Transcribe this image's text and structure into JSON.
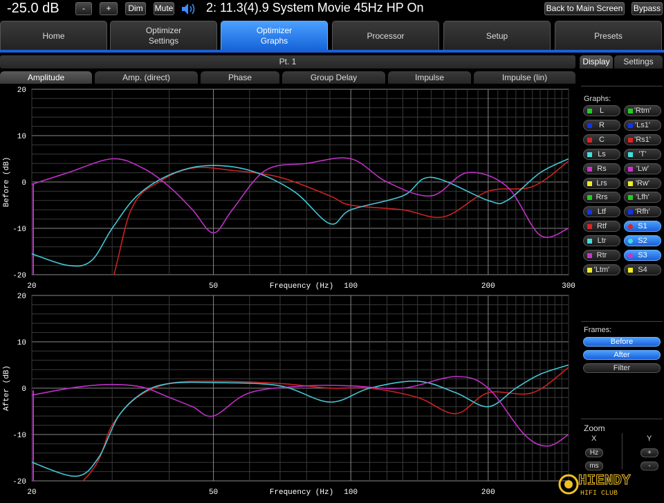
{
  "topbar": {
    "volume": "-25.0 dB",
    "minus_label": "-",
    "plus_label": "+",
    "dim_label": "Dim",
    "mute_label": "Mute",
    "status": "2: 11.3(4).9 System Movie 45Hz HP On",
    "back_label": "Back to Main Screen",
    "bypass_label": "Bypass"
  },
  "tabs": [
    {
      "label": "Home"
    },
    {
      "label": "Optimizer\nSettings"
    },
    {
      "label": "Optimizer\nGraphs"
    },
    {
      "label": "Processor"
    },
    {
      "label": "Setup"
    },
    {
      "label": "Presets"
    }
  ],
  "point_label": "Pt. 1",
  "graph_tabs": [
    "Amplitude",
    "Amp. (direct)",
    "Phase",
    "Group Delay",
    "Impulse",
    "Impulse (lin)"
  ],
  "right_tabs": [
    "Display",
    "Settings"
  ],
  "graphs_label": "Graphs:",
  "channels_left": [
    {
      "label": "L",
      "color": "#22cc22"
    },
    {
      "label": "R",
      "color": "#1133ee"
    },
    {
      "label": "C",
      "color": "#dd2222"
    },
    {
      "label": "Ls",
      "color": "#44dddd"
    },
    {
      "label": "Rs",
      "color": "#cc33cc"
    },
    {
      "label": "Lrs",
      "color": "#eeee22"
    },
    {
      "label": "Rrs",
      "color": "#22cc22"
    },
    {
      "label": "Ltf",
      "color": "#1133ee"
    },
    {
      "label": "Rtf",
      "color": "#dd2222"
    },
    {
      "label": "Ltr",
      "color": "#44dddd"
    },
    {
      "label": "Rtr",
      "color": "#cc33cc"
    },
    {
      "label": "'Ltm'",
      "color": "#eeee22"
    }
  ],
  "channels_right": [
    {
      "label": "'Rtm'",
      "color": "#22cc22"
    },
    {
      "label": "'Ls1'",
      "color": "#1133ee"
    },
    {
      "label": "'Rs1'",
      "color": "#dd2222"
    },
    {
      "label": "'T'",
      "color": "#44dddd"
    },
    {
      "label": "'Lw'",
      "color": "#cc33cc"
    },
    {
      "label": "'Rw'",
      "color": "#eeee22"
    },
    {
      "label": "'Lfh'",
      "color": "#22cc22"
    },
    {
      "label": "'Rfh'",
      "color": "#1133ee"
    },
    {
      "label": "S1",
      "color": "#dd2222",
      "selected": true
    },
    {
      "label": "S2",
      "color": "#44dddd",
      "selected": true
    },
    {
      "label": "S3",
      "color": "#cc33cc",
      "selected": true
    },
    {
      "label": "S4",
      "color": "#eeee22"
    }
  ],
  "frames_label": "Frames:",
  "frames": [
    {
      "label": "Before",
      "selected": true
    },
    {
      "label": "After",
      "selected": true
    },
    {
      "label": "Filter",
      "selected": false
    }
  ],
  "zoom": {
    "label": "Zoom",
    "x_label": "X",
    "y_label": "Y",
    "hz_label": "Hz",
    "ms_label": "ms",
    "plus_label": "+",
    "minus_label": "-"
  },
  "watermark": {
    "text": "HIENDY",
    "subtext": "HIFI CLUB"
  },
  "chart_data": [
    {
      "type": "line",
      "ylabel": "Before (dB)",
      "xlabel": "Frequency (Hz)",
      "xscale": "log",
      "xlim": [
        20,
        300
      ],
      "ylim": [
        -20,
        20
      ],
      "xticks": [
        20,
        50,
        100,
        200,
        300
      ],
      "yticks": [
        20,
        10,
        0,
        -10,
        -20
      ],
      "series": [
        {
          "color": "#cc2222",
          "x": [
            20,
            28,
            33,
            38,
            45,
            55,
            70,
            90,
            100,
            130,
            160,
            200,
            250,
            300
          ],
          "y": [
            -30,
            -28,
            -6,
            0,
            3,
            2.5,
            1,
            -3,
            -5,
            -6,
            -7.5,
            -2,
            -1,
            4.5
          ]
        },
        {
          "color": "#44c8d8",
          "x": [
            20,
            24,
            27,
            30,
            34,
            40,
            48,
            60,
            75,
            90,
            100,
            130,
            150,
            200,
            220,
            260,
            300
          ],
          "y": [
            -15.5,
            -18,
            -17,
            -10,
            -3,
            1.5,
            3.5,
            2.5,
            -2,
            -9,
            -6,
            -3,
            1,
            -4,
            -4,
            2,
            5
          ]
        },
        {
          "color": "#c030c8",
          "x": [
            20,
            24,
            30,
            35,
            40,
            45,
            50,
            55,
            65,
            80,
            100,
            120,
            150,
            180,
            220,
            260,
            300
          ],
          "y": [
            -0.5,
            2,
            5,
            3,
            -1,
            -6,
            -11,
            -6,
            2.5,
            4,
            5,
            0,
            -3,
            2,
            -1,
            -11.5,
            -10
          ]
        }
      ]
    },
    {
      "type": "line",
      "ylabel": "After (dB)",
      "xlabel": "Frequency (Hz)",
      "xscale": "log",
      "xlim": [
        20,
        300
      ],
      "ylim": [
        -20,
        20
      ],
      "xticks": [
        20,
        50,
        100,
        200
      ],
      "yticks": [
        20,
        10,
        0,
        -10,
        -20
      ],
      "series": [
        {
          "color": "#cc2222",
          "x": [
            20,
            27,
            30,
            34,
            40,
            50,
            70,
            90,
            110,
            140,
            170,
            200,
            250,
            300
          ],
          "y": [
            -30,
            -18,
            -8,
            -2,
            1,
            1.5,
            1,
            0,
            0,
            -2,
            -5.5,
            -1,
            -1,
            4.5
          ]
        },
        {
          "color": "#44c8d8",
          "x": [
            20,
            25,
            28,
            31,
            35,
            40,
            50,
            70,
            90,
            110,
            140,
            170,
            200,
            230,
            260,
            300
          ],
          "y": [
            -16,
            -19,
            -15,
            -6,
            -1,
            1,
            1.2,
            0.5,
            -3,
            0,
            1.5,
            -1,
            -4,
            0,
            3,
            5
          ]
        },
        {
          "color": "#c030c8",
          "x": [
            20,
            25,
            30,
            35,
            40,
            45,
            50,
            60,
            80,
            100,
            130,
            170,
            200,
            240,
            270,
            300
          ],
          "y": [
            -1.5,
            0.2,
            0.8,
            0.2,
            -2,
            -4,
            -6,
            -1,
            0.5,
            0.5,
            0,
            2.5,
            0,
            -10,
            -12.5,
            -10
          ]
        }
      ]
    }
  ]
}
